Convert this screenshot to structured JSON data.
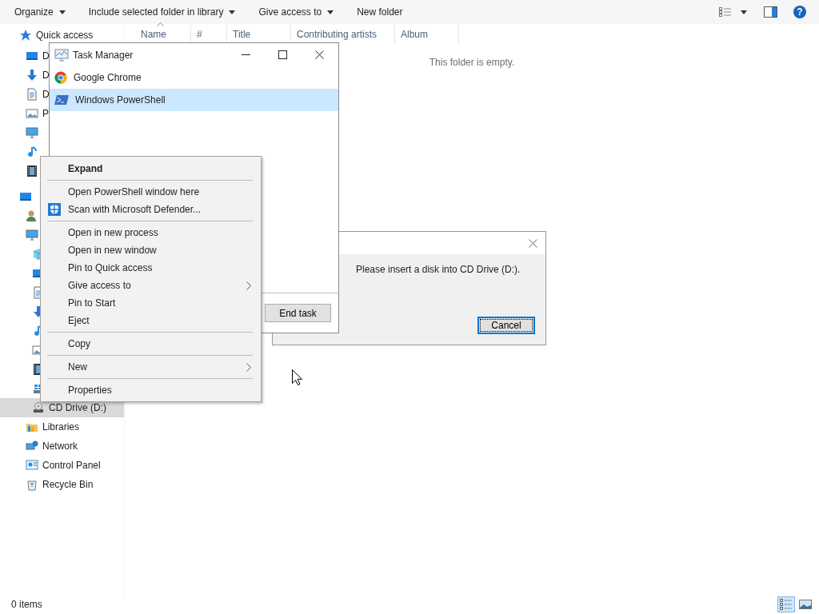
{
  "toolbar": {
    "buttons": [
      {
        "label": "Organize",
        "dropdown": true
      },
      {
        "label": "Include selected folder in library",
        "dropdown": true
      },
      {
        "label": "Give access to",
        "dropdown": true
      },
      {
        "label": "New folder",
        "dropdown": false
      }
    ],
    "help": "?"
  },
  "sidebar": {
    "items": [
      {
        "label": "Quick access",
        "kind": "star",
        "selected": false,
        "children": [
          {
            "label": "D",
            "kind": "desktop",
            "selected": false
          },
          {
            "label": "D",
            "kind": "download",
            "selected": false
          },
          {
            "label": "D",
            "kind": "document",
            "selected": false
          },
          {
            "label": "P",
            "kind": "pictures",
            "selected": false
          },
          {
            "kind": "monitor",
            "selected": false
          },
          {
            "kind": "music",
            "selected": false
          },
          {
            "kind": "video",
            "selected": false
          }
        ]
      },
      {
        "kind": "desktop",
        "selected": false,
        "children": [
          {
            "kind": "user",
            "selected": false
          },
          {
            "kind": "monitor",
            "selected": false,
            "children": [
              {
                "kind": "cube",
                "selected": false
              },
              {
                "kind": "desktop",
                "selected": false
              },
              {
                "kind": "document",
                "selected": false
              },
              {
                "kind": "download",
                "selected": false
              },
              {
                "kind": "music",
                "selected": false
              },
              {
                "kind": "pictures",
                "selected": false
              },
              {
                "kind": "video",
                "selected": false
              },
              {
                "kind": "drive",
                "selected": false
              },
              {
                "label": "CD Drive (D:)",
                "kind": "disc",
                "selected": true
              }
            ]
          },
          {
            "label": "Libraries",
            "kind": "libraries",
            "selected": false
          },
          {
            "label": "Network",
            "kind": "network",
            "selected": false
          },
          {
            "label": "Control Panel",
            "kind": "controlpanel",
            "selected": false
          },
          {
            "label": "Recycle Bin",
            "kind": "bin",
            "selected": false
          }
        ]
      }
    ]
  },
  "columns": [
    {
      "label": "Name",
      "sorted": true
    },
    {
      "label": "#",
      "sorted": false
    },
    {
      "label": "Title",
      "sorted": false
    },
    {
      "label": "Contributing artists",
      "sorted": false
    },
    {
      "label": "Album",
      "sorted": false
    }
  ],
  "empty_message": "This folder is empty.",
  "status_bar": {
    "item_count": "0 items",
    "views": [
      {
        "kind": "details",
        "selected": true
      },
      {
        "kind": "icons",
        "selected": false
      }
    ]
  },
  "dialog": {
    "message": "Please insert a disk into CD Drive (D:).",
    "button": "Cancel"
  },
  "task_manager": {
    "title": "Task Manager",
    "items": [
      {
        "label": "Google Chrome",
        "kind": "chrome",
        "selected": false
      },
      {
        "label": "Windows PowerShell",
        "kind": "powershell",
        "selected": true
      }
    ],
    "end_task": "End task"
  },
  "context_menu": {
    "items": [
      {
        "kind": "item",
        "label": "Expand",
        "bold": true,
        "submenu": false
      },
      {
        "kind": "separator"
      },
      {
        "kind": "item",
        "label": "Open PowerShell window here",
        "bold": false,
        "submenu": false
      },
      {
        "kind": "scan",
        "label": "Scan with Microsoft Defender...",
        "bold": false,
        "submenu": false
      },
      {
        "kind": "separator"
      },
      {
        "kind": "item",
        "label": "Open in new process",
        "bold": false,
        "submenu": false
      },
      {
        "kind": "item",
        "label": "Open in new window",
        "bold": false,
        "submenu": false
      },
      {
        "kind": "item",
        "label": "Pin to Quick access",
        "bold": false,
        "submenu": false
      },
      {
        "kind": "item",
        "label": "Give access to",
        "bold": false,
        "submenu": true
      },
      {
        "kind": "item",
        "label": "Pin to Start",
        "bold": false,
        "submenu": false
      },
      {
        "kind": "item",
        "label": "Eject",
        "bold": false,
        "submenu": false
      },
      {
        "kind": "separator"
      },
      {
        "kind": "item",
        "label": "Copy",
        "bold": false,
        "submenu": false
      },
      {
        "kind": "separator"
      },
      {
        "kind": "item",
        "label": "New",
        "bold": false,
        "submenu": true
      },
      {
        "kind": "separator"
      },
      {
        "kind": "item",
        "label": "Properties",
        "bold": false,
        "submenu": false
      }
    ]
  }
}
